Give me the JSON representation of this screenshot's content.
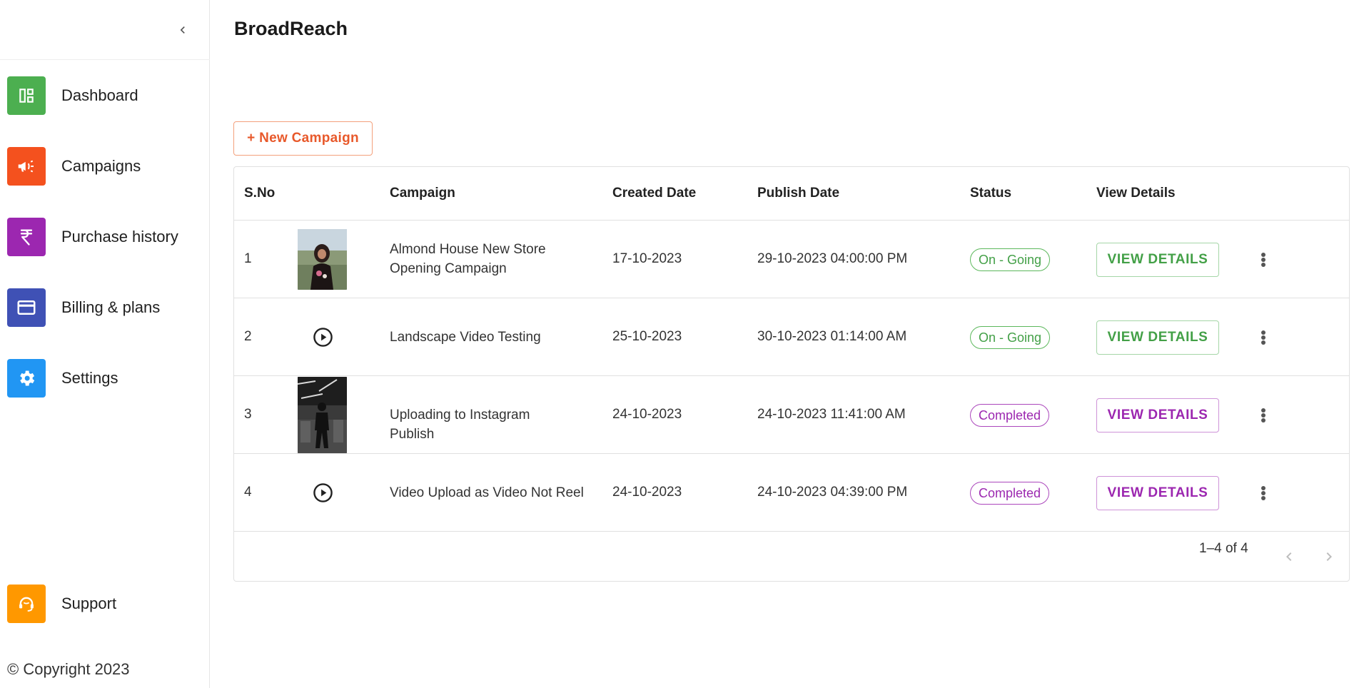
{
  "app": {
    "title": "BroadReach"
  },
  "sidebar": {
    "collapse_icon": "chevron-left-icon",
    "items": [
      {
        "label": "Dashboard",
        "icon": "dashboard-icon",
        "color": "#4caf50"
      },
      {
        "label": "Campaigns",
        "icon": "megaphone-icon",
        "color": "#f4511e"
      },
      {
        "label": "Purchase history",
        "icon": "rupee-icon",
        "color": "#9c27b0"
      },
      {
        "label": "Billing & plans",
        "icon": "credit-card-icon",
        "color": "#3f51b5"
      },
      {
        "label": "Settings",
        "icon": "gear-icon",
        "color": "#2196f3"
      }
    ],
    "support": {
      "label": "Support",
      "icon": "support-agent-icon",
      "color": "#ff9800"
    },
    "copyright": "© Copyright 2023"
  },
  "toolbar": {
    "new_campaign_label": "+ New Campaign"
  },
  "table": {
    "headers": {
      "sno": "S.No",
      "campaign": "Campaign",
      "created": "Created Date",
      "publish": "Publish Date",
      "status": "Status",
      "view": "View Details"
    },
    "rows": [
      {
        "sno": "1",
        "media": "image",
        "campaign": "Almond House New Store Opening Campaign",
        "created": "17-10-2023",
        "publish": "29-10-2023 04:00:00 PM",
        "status": "On - Going",
        "status_color": "#43a047",
        "action": "VIEW DETAILS"
      },
      {
        "sno": "2",
        "media": "video",
        "campaign": "Landscape Video Testing",
        "created": "25-10-2023",
        "publish": "30-10-2023 01:14:00 AM",
        "status": "On - Going",
        "status_color": "#43a047",
        "action": "VIEW DETAILS"
      },
      {
        "sno": "3",
        "media": "image",
        "campaign": "Uploading to Instagram Publish",
        "created": "24-10-2023",
        "publish": "24-10-2023 11:41:00 AM",
        "status": "Completed",
        "status_color": "#9c27b0",
        "action": "VIEW DETAILS"
      },
      {
        "sno": "4",
        "media": "video",
        "campaign": "Video Upload as Video Not Reel",
        "created": "24-10-2023",
        "publish": "24-10-2023 04:39:00 PM",
        "status": "Completed",
        "status_color": "#9c27b0",
        "action": "VIEW DETAILS"
      }
    ],
    "pagination": {
      "range": "1–4 of 4"
    }
  }
}
